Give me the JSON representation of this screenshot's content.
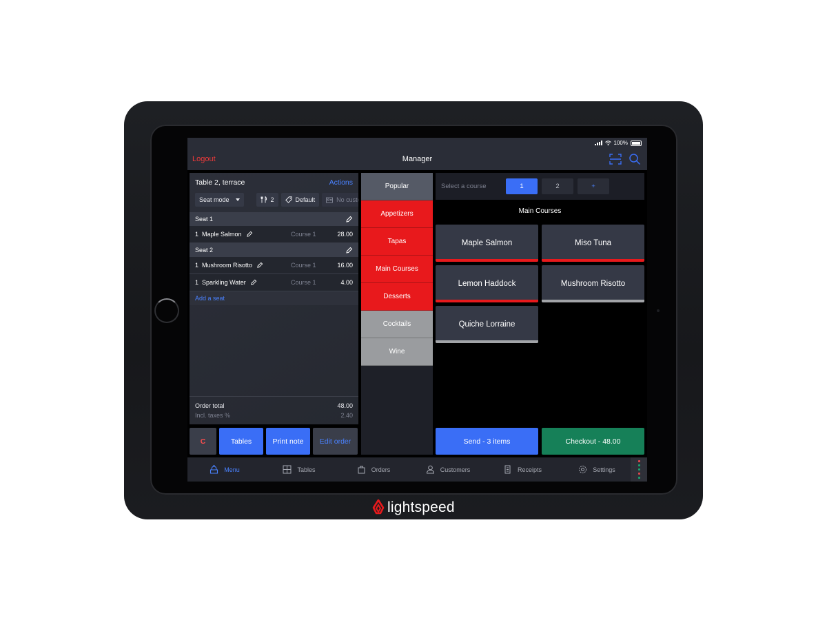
{
  "device": {
    "brand_name": "lightspeed"
  },
  "status_bar": {
    "battery": "100%"
  },
  "topbar": {
    "logout_label": "Logout",
    "title": "Manager"
  },
  "order": {
    "table_name": "Table 2, terrace",
    "actions_label": "Actions",
    "seat_mode_label": "Seat mode",
    "covers": "2",
    "price_list": "Default",
    "customer": "No customer",
    "seats": [
      {
        "label": "Seat 1",
        "items": [
          {
            "qty": "1",
            "name": "Maple Salmon",
            "course": "Course 1",
            "price": "28.00"
          }
        ]
      },
      {
        "label": "Seat 2",
        "items": [
          {
            "qty": "1",
            "name": "Mushroom Risotto",
            "course": "Course 1",
            "price": "16.00"
          },
          {
            "qty": "1",
            "name": "Sparkling Water",
            "course": "Course 1",
            "price": "4.00"
          }
        ]
      }
    ],
    "add_seat_label": "Add a seat",
    "total_label": "Order total",
    "total_value": "48.00",
    "taxes_label": "Incl. taxes %",
    "taxes_value": "2.40"
  },
  "left_buttons": {
    "clear_label": "C",
    "tables_label": "Tables",
    "print_note_label": "Print note",
    "edit_order_label": "Edit order"
  },
  "categories": [
    {
      "label": "Popular",
      "style": "popular"
    },
    {
      "label": "Appetizers",
      "style": "red"
    },
    {
      "label": "Tapas",
      "style": "red"
    },
    {
      "label": "Main Courses",
      "style": "red"
    },
    {
      "label": "Desserts",
      "style": "red"
    },
    {
      "label": "Cocktails",
      "style": "grey"
    },
    {
      "label": "Wine",
      "style": "grey"
    }
  ],
  "course_selector": {
    "label": "Select a course",
    "options": [
      "1",
      "2",
      "+"
    ],
    "selected": "1"
  },
  "section_title": "Main Courses",
  "products": [
    {
      "name": "Maple Salmon",
      "bar_color": "#e8191c"
    },
    {
      "name": "Miso Tuna",
      "bar_color": "#e8191c"
    },
    {
      "name": "Lemon Haddock",
      "bar_color": "#e8191c"
    },
    {
      "name": "Mushroom Risotto",
      "bar_color": "#a2a4a8"
    },
    {
      "name": "Quiche Lorraine",
      "bar_color": "#a2a4a8"
    }
  ],
  "actions": {
    "send_label": "Send - 3 items",
    "checkout_label": "Checkout - 48.00"
  },
  "nav": {
    "items": [
      {
        "label": "Menu",
        "icon": "menu-icon",
        "active": true
      },
      {
        "label": "Tables",
        "icon": "tables-icon",
        "active": false
      },
      {
        "label": "Orders",
        "icon": "orders-icon",
        "active": false
      },
      {
        "label": "Customers",
        "icon": "customers-icon",
        "active": false
      },
      {
        "label": "Receipts",
        "icon": "receipts-icon",
        "active": false
      },
      {
        "label": "Settings",
        "icon": "settings-icon",
        "active": false
      }
    ],
    "status_dots": [
      "#e0484e",
      "#1aa36f",
      "#1aa36f",
      "#e0484e",
      "#1aa36f"
    ]
  },
  "colors": {
    "accent_blue": "#3a6ef6",
    "link_blue": "#4a82ff",
    "danger_red": "#e8191c",
    "checkout_green": "#168058"
  }
}
